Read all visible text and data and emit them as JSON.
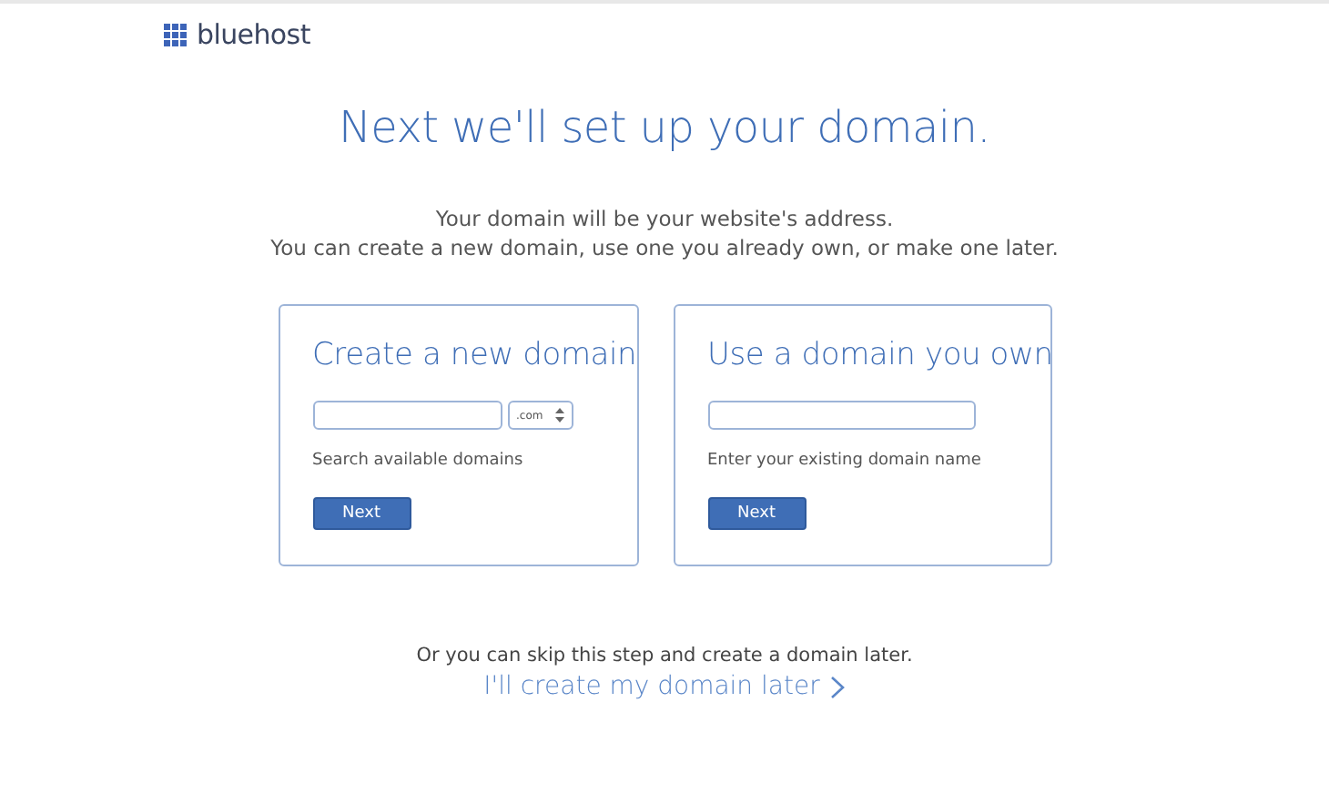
{
  "logo": {
    "text": "bluehost"
  },
  "title": "Next we'll set up your domain.",
  "intro": [
    "Your domain will be your website's address.",
    "You can create a new domain, use one you already own, or make one later."
  ],
  "cards": [
    {
      "kind": "create",
      "heading": "Create a new domain",
      "tld": ".com",
      "hint": "Search available domains",
      "button": "Next"
    },
    {
      "kind": "existing",
      "heading": "Use a domain you own",
      "hint": "Enter your existing domain name",
      "button": "Next"
    }
  ],
  "skip": {
    "text": "Or you can skip this step and create a domain later.",
    "link": "I'll create my domain later"
  }
}
